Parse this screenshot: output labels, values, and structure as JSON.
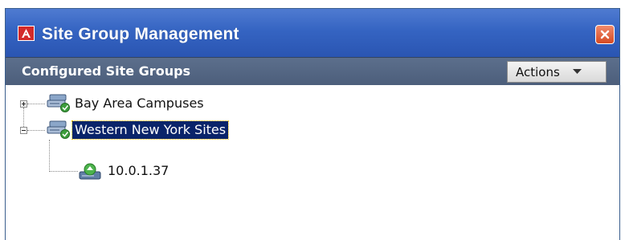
{
  "window": {
    "title": "Site Group Management"
  },
  "header": {
    "title": "Configured Site Groups",
    "actions_label": "Actions"
  },
  "tree": {
    "groups": [
      {
        "label": "Bay Area Campuses",
        "expanded": false
      },
      {
        "label": "Western New York Sites",
        "expanded": true,
        "selected": true,
        "children": [
          {
            "label": "10.0.1.37"
          }
        ]
      }
    ]
  },
  "colors": {
    "titlebar": "#3564c2",
    "header": "#55677f",
    "selection": "#0a246a",
    "close": "#d64a22"
  }
}
